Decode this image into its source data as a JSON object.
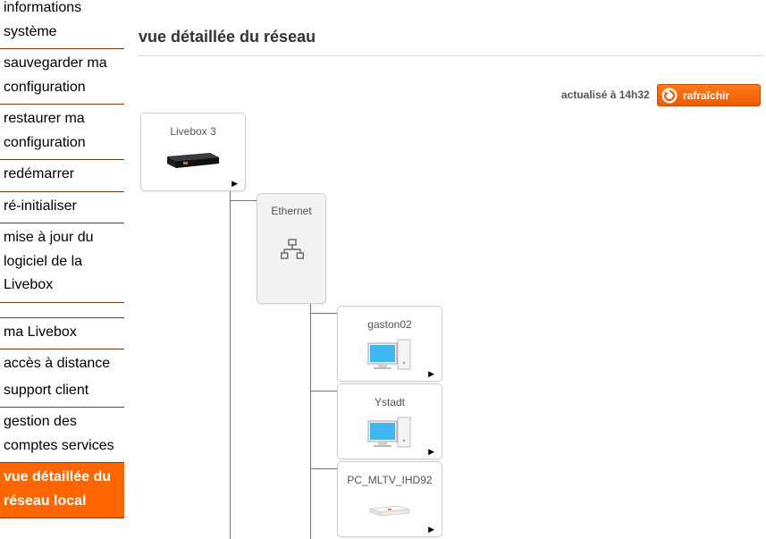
{
  "sidebar": {
    "items": [
      {
        "id": "informations-systeme",
        "label": "informations système"
      },
      {
        "id": "sauvegarder",
        "label": "sauvegarder ma configuration"
      },
      {
        "id": "restaurer",
        "label": "restaurer ma configuration"
      },
      {
        "id": "redemarrer",
        "label": "redémarrer"
      },
      {
        "id": "reinitialiser",
        "label": "ré-initialiser"
      },
      {
        "id": "mise-a-jour",
        "label": "mise à jour du logiciel de la Livebox"
      },
      {
        "id": "ma-livebox",
        "label": "ma Livebox"
      },
      {
        "id": "acces-distance",
        "label": "accès à distance"
      },
      {
        "id": "support-client",
        "label": "support client"
      },
      {
        "id": "gestion-comptes",
        "label": "gestion des comptes services"
      },
      {
        "id": "vue-reseau",
        "label": "vue détaillée du réseau local",
        "active": true
      }
    ]
  },
  "main": {
    "title": "vue détaillée du réseau",
    "updated": "actualisé à 14h32",
    "refresh_label": "rafraîchir"
  },
  "tree": {
    "root": {
      "label": "Livebox 3",
      "icon": "livebox-router-icon"
    },
    "interface": {
      "label": "Ethernet",
      "icon": "ethernet-network-icon"
    },
    "devices": [
      {
        "label": "gaston02",
        "icon": "desktop-computer-icon"
      },
      {
        "label": "Ystadt",
        "icon": "desktop-computer-icon"
      },
      {
        "label": "PC_MLTV_IHD92",
        "icon": "tv-decoder-icon"
      }
    ]
  },
  "colors": {
    "accent": "#ff6600",
    "sidebar_border": "#7a3a12",
    "title": "#333333"
  }
}
